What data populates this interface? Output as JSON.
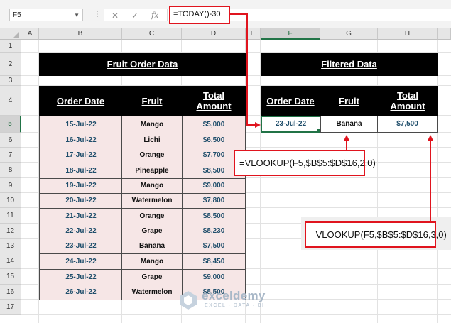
{
  "formula_bar": {
    "name_box": "F5",
    "cancel_icon": "✕",
    "enter_icon": "✓",
    "fx_label": "fx",
    "formula": "=TODAY()-30"
  },
  "columns": [
    "A",
    "B",
    "C",
    "D",
    "E",
    "F",
    "G",
    "H"
  ],
  "rows": [
    "1",
    "2",
    "3",
    "4",
    "5",
    "6",
    "7",
    "8",
    "9",
    "10",
    "11",
    "12",
    "13",
    "14",
    "15",
    "16",
    "17"
  ],
  "selected_column": "F",
  "selected_row": "5",
  "left_table": {
    "title": "Fruit Order Data",
    "headers": [
      "Order Date",
      "Fruit",
      "Total Amount"
    ],
    "rows": [
      [
        "15-Jul-22",
        "Mango",
        "$5,000"
      ],
      [
        "16-Jul-22",
        "Lichi",
        "$6,500"
      ],
      [
        "17-Jul-22",
        "Orange",
        "$7,700"
      ],
      [
        "18-Jul-22",
        "Pineapple",
        "$8,500"
      ],
      [
        "19-Jul-22",
        "Mango",
        "$9,000"
      ],
      [
        "20-Jul-22",
        "Watermelon",
        "$7,800"
      ],
      [
        "21-Jul-22",
        "Orange",
        "$8,500"
      ],
      [
        "22-Jul-22",
        "Grape",
        "$8,230"
      ],
      [
        "23-Jul-22",
        "Banana",
        "$7,500"
      ],
      [
        "24-Jul-22",
        "Mango",
        "$8,450"
      ],
      [
        "25-Jul-22",
        "Grape",
        "$9,000"
      ],
      [
        "26-Jul-22",
        "Watermelon",
        "$8,500"
      ]
    ]
  },
  "right_table": {
    "title": "Filtered Data",
    "headers": [
      "Order Date",
      "Fruit",
      "Total Amount"
    ],
    "row": [
      "23-Jul-22",
      "Banana",
      "$7,500"
    ]
  },
  "annotations": {
    "fruit_formula": "=VLOOKUP(F5,$B$5:$D$16,2,0)",
    "amount_formula": "=VLOOKUP(F5,$B$5:$D$16,3,0)"
  },
  "watermark": {
    "name": "exceldemy",
    "tagline": "EXCEL · DATA · BI"
  },
  "colors": {
    "accent_red": "#e0141e",
    "excel_green": "#217346",
    "table_fill": "#f6e6e6",
    "header_black": "#000000"
  }
}
